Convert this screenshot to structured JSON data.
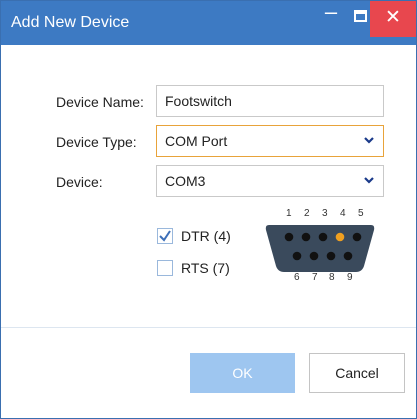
{
  "window": {
    "title": "Add New Device",
    "minimize_icon": "minimize-icon",
    "maximize_icon": "maximize-icon",
    "close_icon": "close-icon",
    "close_color": "#e8474e",
    "titlebar_color": "#3d7ac3"
  },
  "form": {
    "device_name_label": "Device Name:",
    "device_name_value": "Footswitch",
    "device_type_label": "Device Type:",
    "device_type_value": "COM Port",
    "device_label": "Device:",
    "device_value": "COM3",
    "dropdown_icon": "chevron-down-icon",
    "focus_color": "#e8a33a"
  },
  "signals": {
    "dtr_label": "DTR (4)",
    "dtr_checked": true,
    "rts_label": "RTS (7)",
    "rts_checked": false
  },
  "connector": {
    "top_pins": [
      "1",
      "2",
      "3",
      "4",
      "5"
    ],
    "bottom_pins": [
      "6",
      "7",
      "8",
      "9"
    ],
    "active_pin": "4",
    "active_color": "#f0a020"
  },
  "buttons": {
    "ok_label": "OK",
    "cancel_label": "Cancel"
  }
}
